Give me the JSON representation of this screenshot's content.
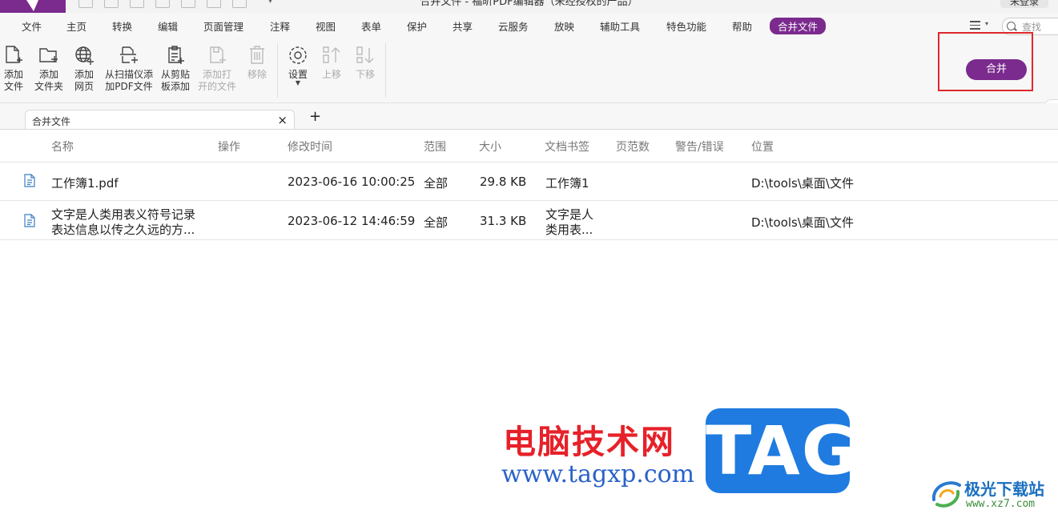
{
  "window": {
    "title": "合并文件 - 福昕PDF编辑器（未经授权的产品）",
    "login_label": "未登录"
  },
  "menu": {
    "items": [
      "文件",
      "主页",
      "转换",
      "编辑",
      "页面管理",
      "注释",
      "视图",
      "表单",
      "保护",
      "共享",
      "云服务",
      "放映",
      "辅助工具",
      "特色功能",
      "帮助",
      "合并文件"
    ],
    "active": "合并文件",
    "search_placeholder": "查找"
  },
  "ribbon": {
    "add_file": "添加\n文件",
    "add_folder": "添加\n文件夹",
    "add_webpage": "添加\n网页",
    "add_from_scanner": "从扫描仪添\n加PDF文件",
    "add_from_clipboard": "从剪贴\n板添加",
    "add_open_files": "添加打\n开的文件",
    "remove": "移除",
    "settings": "设置",
    "move_up": "上移",
    "move_down": "下移",
    "merge": "合并"
  },
  "tabs": {
    "active_tab": "合并文件",
    "close_glyph": "×",
    "add_glyph": "+"
  },
  "table": {
    "columns": [
      "名称",
      "操作",
      "修改时间",
      "范围",
      "大小",
      "文档书签",
      "页范数",
      "警告/错误",
      "位置"
    ],
    "rows": [
      {
        "name": "工作簿1.pdf",
        "name_line2": "",
        "modified": "2023-06-16 10:00:25",
        "range": "全部",
        "size": "29.8 KB",
        "bookmark": "工作簿1",
        "bookmark_line2": "",
        "location": "D:\\tools\\桌面\\文件"
      },
      {
        "name": "文字是人类用表义符号记录",
        "name_line2": "表达信息以传之久远的方...",
        "modified": "2023-06-12 14:46:59",
        "range": "全部",
        "size": "31.3 KB",
        "bookmark": "文字是人",
        "bookmark_line2": "类用表...",
        "location": "D:\\tools\\桌面\\文件"
      }
    ]
  },
  "watermark": {
    "site_name": "电脑技术网",
    "site_url": "www.tagxp.com",
    "badge": "TAG",
    "corner_title": "极光下载站",
    "corner_url": "www.xz7.com"
  },
  "colors": {
    "accent": "#7b2a8e",
    "highlight": "#e0282c",
    "watermark_red": "#e62129",
    "watermark_blue": "#1f7be0"
  }
}
